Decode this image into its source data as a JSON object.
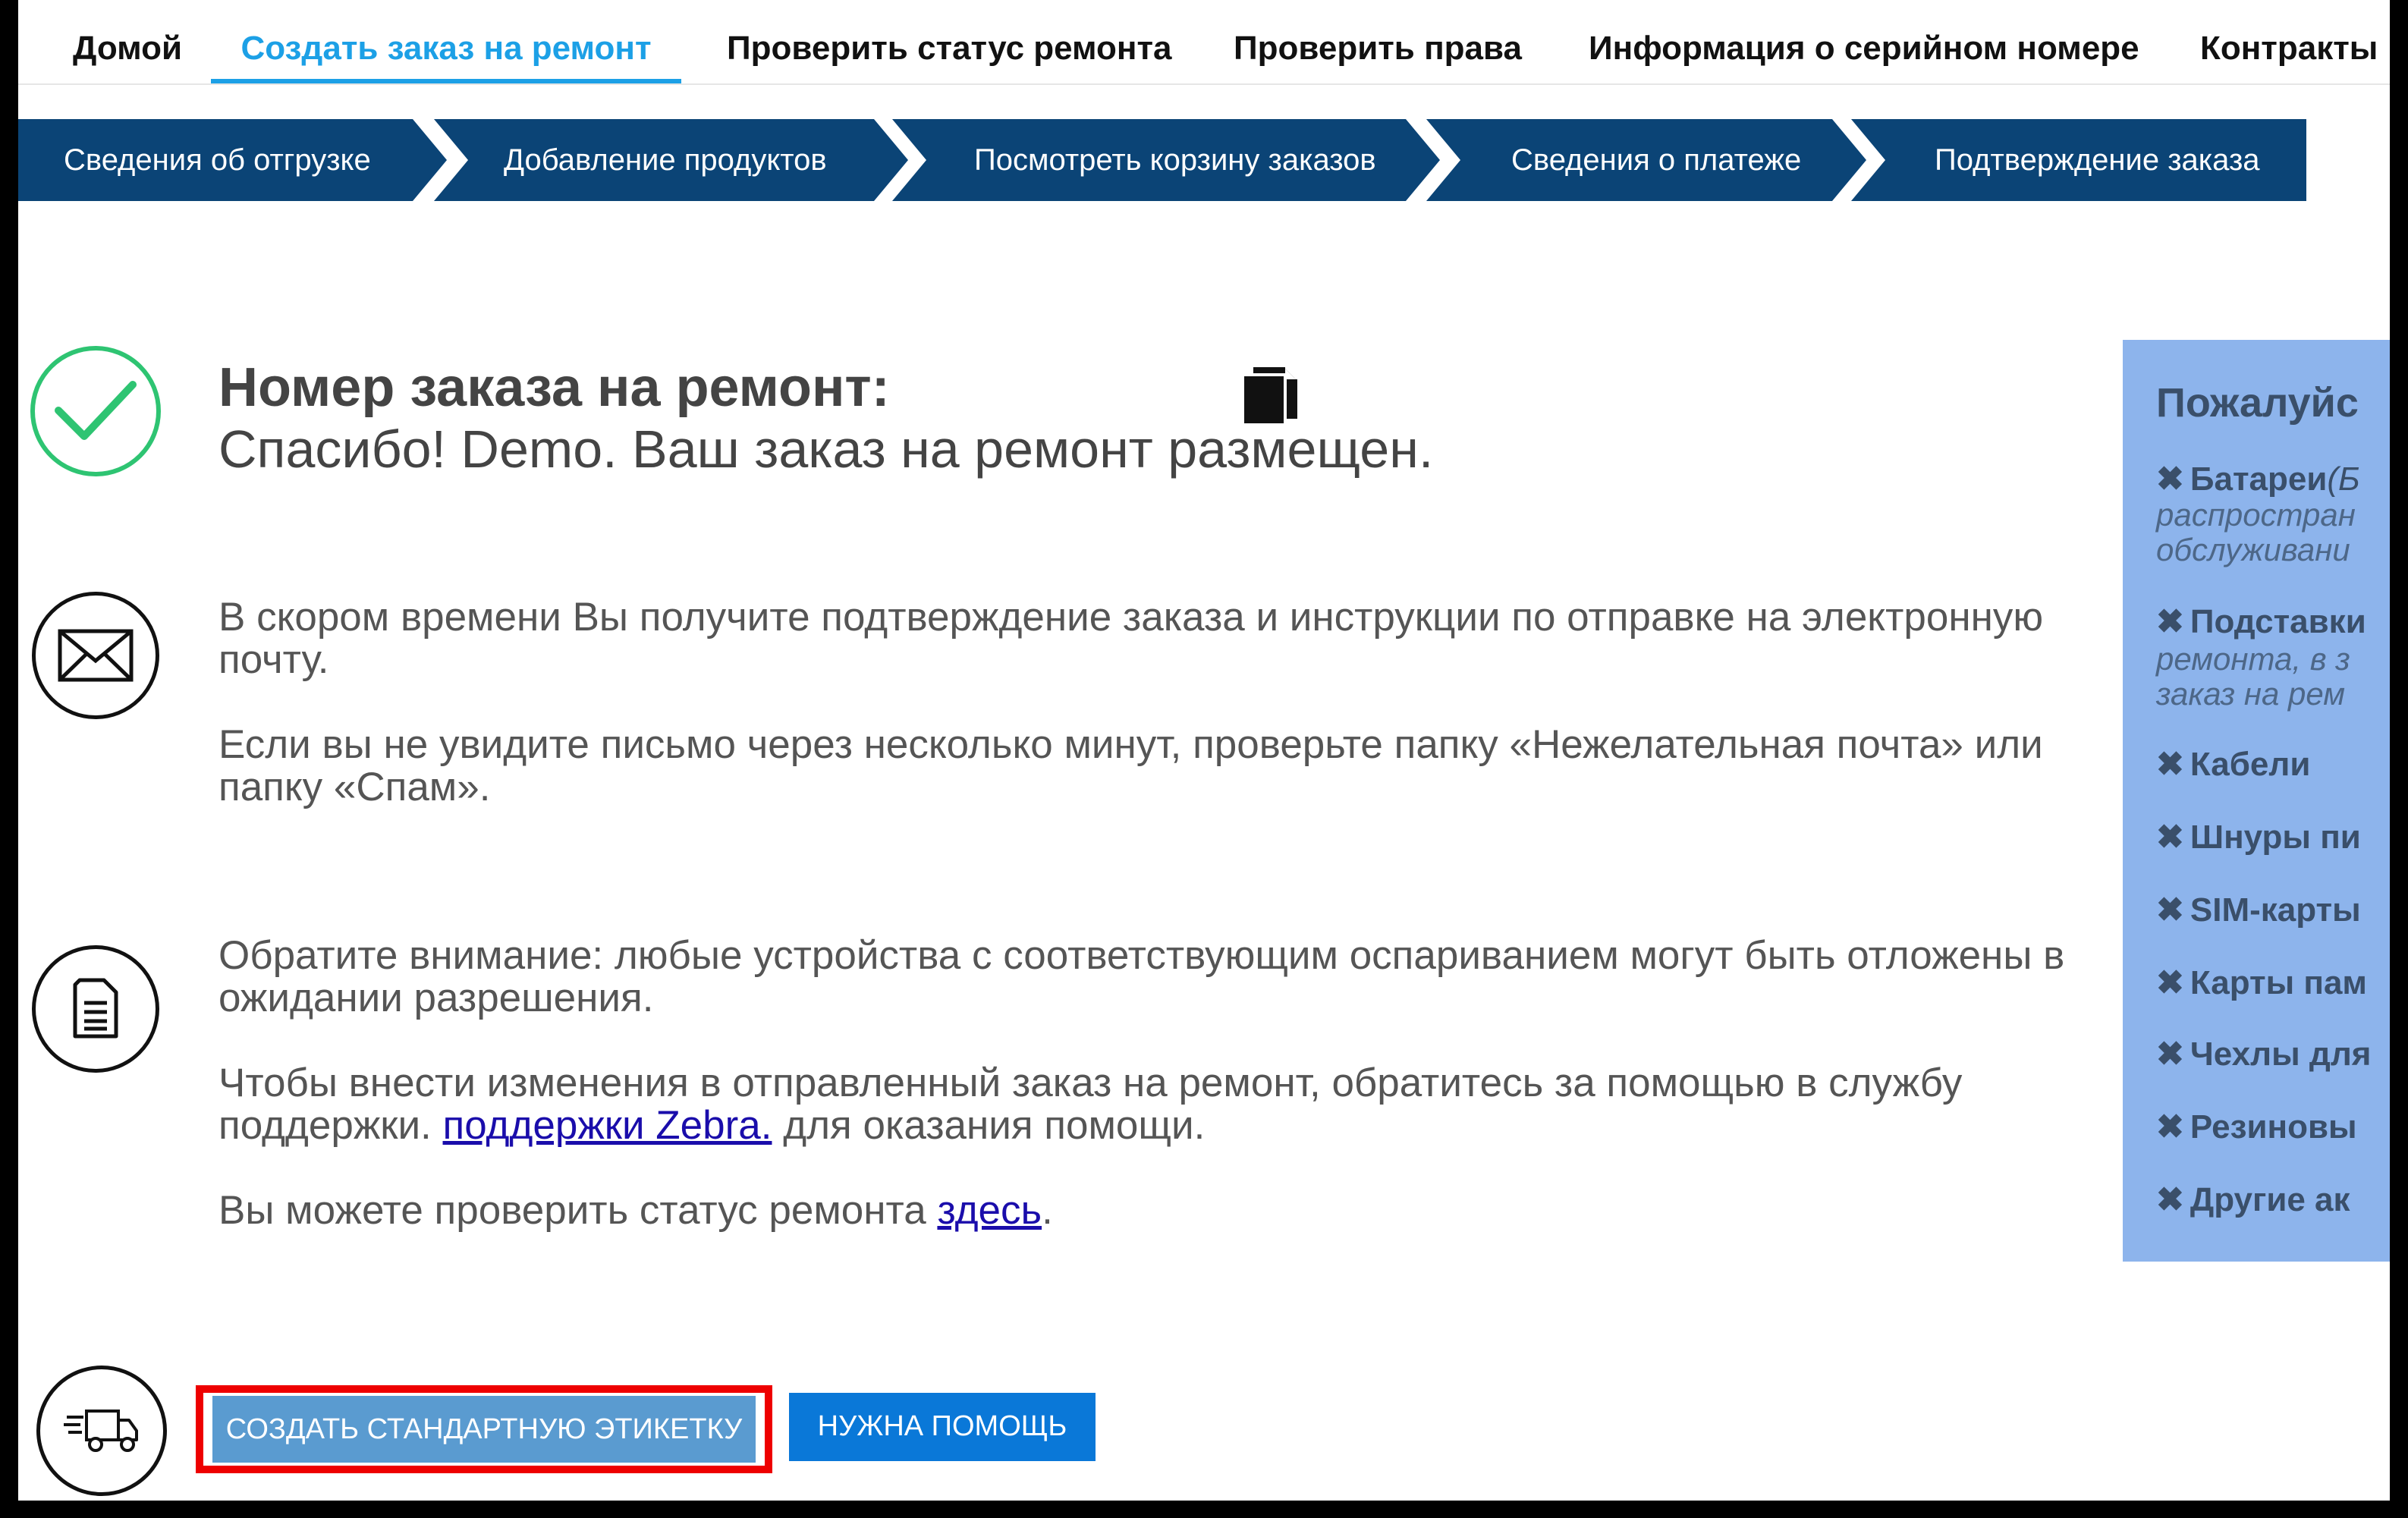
{
  "topnav": {
    "items": [
      {
        "label": "Домой"
      },
      {
        "label": "Создать заказ на ремонт"
      },
      {
        "label": "Проверить статус ремонта"
      },
      {
        "label": "Проверить права"
      },
      {
        "label": "Информация о серийном номере"
      },
      {
        "label": "Контракты"
      }
    ],
    "active": "Создать заказ на ремонт",
    "active_color": "#1ca0e6"
  },
  "steps": {
    "items": [
      {
        "label": "Сведения об отгрузке"
      },
      {
        "label": "Добавление продуктов"
      },
      {
        "label": "Посмотреть корзину заказов"
      },
      {
        "label": "Сведения о платеже"
      },
      {
        "label": "Подтверждение заказа"
      }
    ],
    "color": "#0b4476"
  },
  "confirmation": {
    "title": "Номер заказа на ремонт:",
    "subtitle": "Спасибо! Demo. Ваш заказ на ремонт размещен."
  },
  "email_block": {
    "p1": "В скором времени Вы получите подтверждение заказа и инструкции по отправке на электронную почту.",
    "p2": "Если вы не увидите письмо через несколько минут, проверьте папку «Нежелательная почта» или папку «Спам»."
  },
  "notes_block": {
    "p1": "Обратите внимание: любые устройства с соответствующим оспариванием могут быть отложены в ожидании разрешения.",
    "p2_before": "Чтобы внести изменения в отправленный заказ на ремонт, обратитесь за помощью в службу поддержки. ",
    "p2_link": " поддержки Zebra.",
    "p2_after": " для оказания помощи.",
    "p3_before": "Вы можете проверить статус ремонта ",
    "p3_link": "здесь",
    "p3_after": "."
  },
  "sidepanel": {
    "title": "Пожалуйс",
    "items": [
      {
        "label": "Батареи",
        "suffix": "(Б",
        "sub": [
          "распростран",
          "обслуживани"
        ]
      },
      {
        "label": "Подставки",
        "suffix": "",
        "sub": [
          "ремонта, в з",
          "заказ на рем"
        ]
      },
      {
        "label": "Кабели",
        "suffix": "",
        "sub": []
      },
      {
        "label": "Шнуры пи",
        "suffix": "",
        "sub": []
      },
      {
        "label": "SIM-карты",
        "suffix": "",
        "sub": []
      },
      {
        "label": "Карты пам",
        "suffix": "",
        "sub": []
      },
      {
        "label": "Чехлы для",
        "suffix": "",
        "sub": []
      },
      {
        "label": "Резиновы",
        "suffix": "",
        "sub": []
      },
      {
        "label": "Другие ак",
        "suffix": "",
        "sub": []
      }
    ],
    "bg_color": "#8db4ec"
  },
  "buttons": {
    "create_label": "СОЗДАТЬ СТАНДАРТНУЮ ЭТИКЕТКУ",
    "help_label": "НУЖНА ПОМОЩЬ"
  },
  "icons": {
    "success": "check-circle-icon",
    "email": "envelope-icon",
    "document": "document-icon",
    "shipping": "delivery-truck-icon",
    "copy": "copy-icon"
  }
}
